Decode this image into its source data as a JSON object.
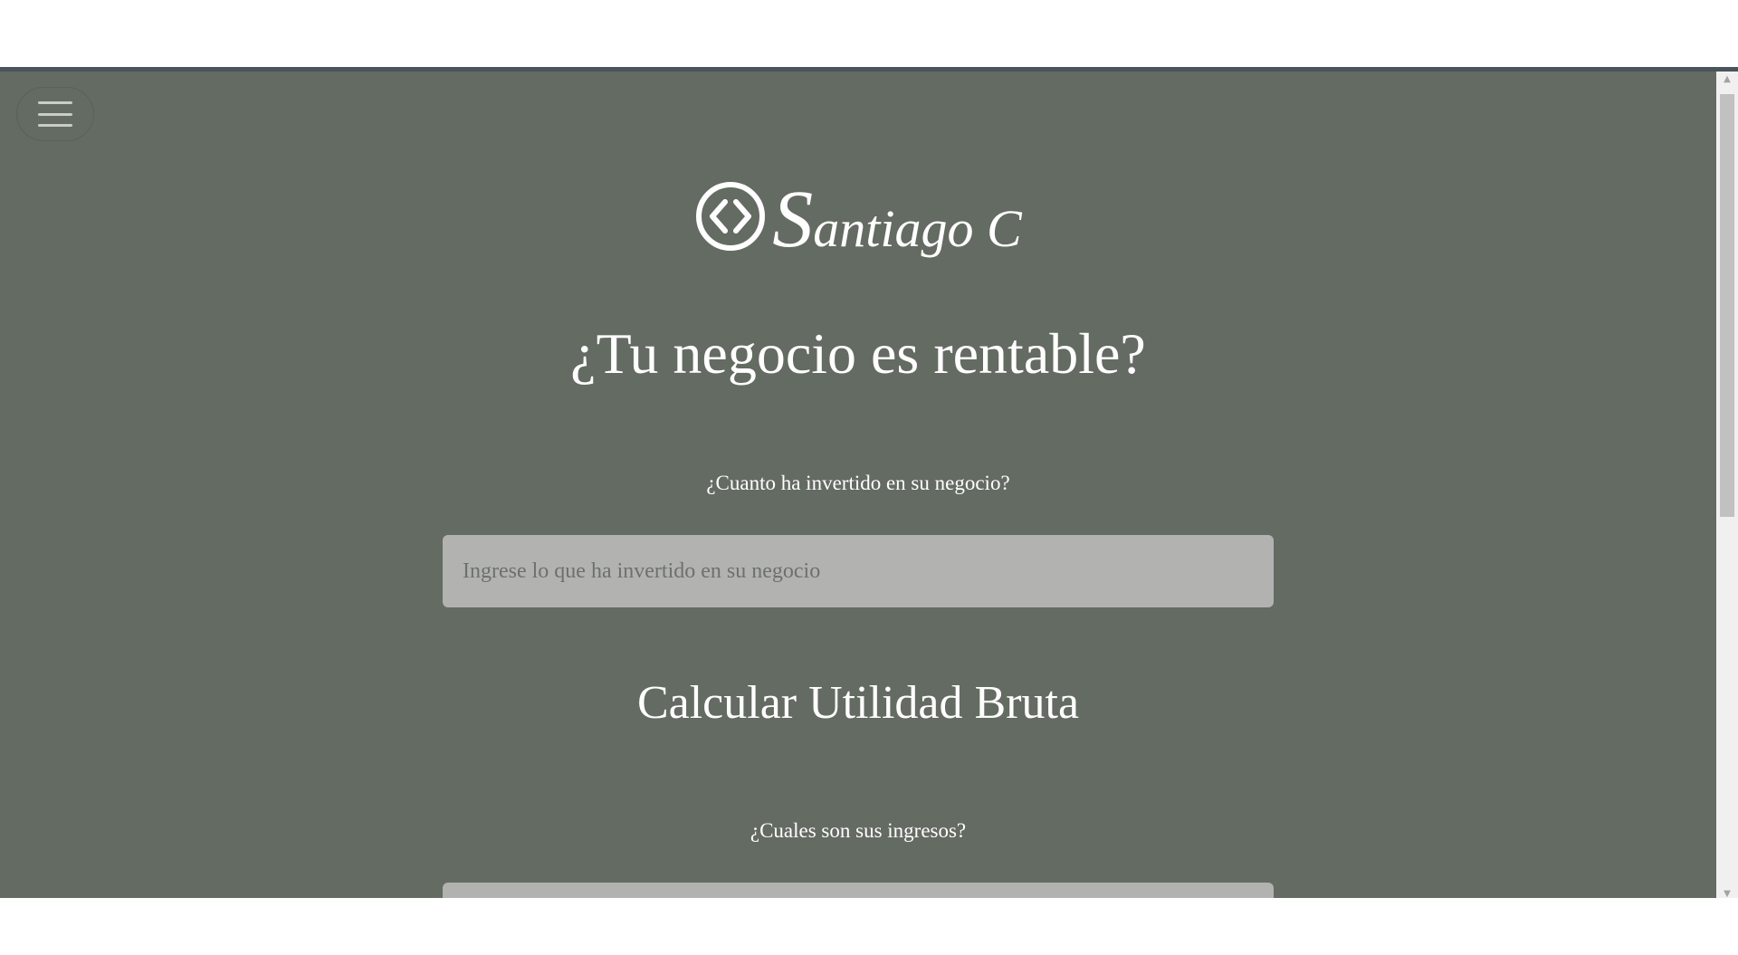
{
  "logo": {
    "initial": "S",
    "rest": "antiago C"
  },
  "header": {
    "title": "¿Tu negocio es rentable?"
  },
  "form": {
    "investment_question": "¿Cuanto ha invertido en su negocio?",
    "investment_placeholder": "Ingrese lo que ha invertido en su negocio",
    "section_title": "Calcular Utilidad Bruta",
    "income_question": "¿Cuales son sus ingresos?",
    "income_placeholder": ""
  },
  "icons": {
    "menu": "hamburger-menu-icon",
    "logo": "code-brackets-circle-icon"
  },
  "colors": {
    "page_background": "#646b62",
    "input_background": "#b2b3b1",
    "text": "#ffffff"
  }
}
